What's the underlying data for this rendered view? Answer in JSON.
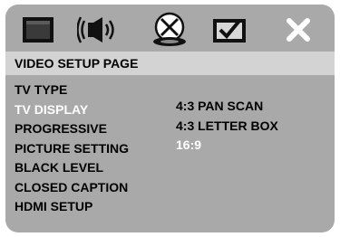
{
  "page_title": "VIDEO SETUP PAGE",
  "tabs": [
    {
      "icon": "monitor-icon"
    },
    {
      "icon": "speaker-icon"
    },
    {
      "icon": "video-disc-icon",
      "active": true
    },
    {
      "icon": "checkmark-box-icon"
    },
    {
      "icon": "close-icon"
    }
  ],
  "menu_items": [
    {
      "label": "TV TYPE"
    },
    {
      "label": "TV DISPLAY",
      "highlighted": true
    },
    {
      "label": "PROGRESSIVE"
    },
    {
      "label": "PICTURE SETTING"
    },
    {
      "label": "BLACK LEVEL"
    },
    {
      "label": "CLOSED CAPTION"
    },
    {
      "label": "HDMI SETUP"
    }
  ],
  "options": [
    {
      "label": "4:3 PAN SCAN"
    },
    {
      "label": "4:3 LETTER BOX"
    },
    {
      "label": "16:9",
      "selected": true
    }
  ],
  "colors": {
    "panel_bg": "#a9a9a9",
    "title_bar_bg": "#d3d3d3",
    "text": "#000000",
    "highlight_text": "#ffffff"
  }
}
